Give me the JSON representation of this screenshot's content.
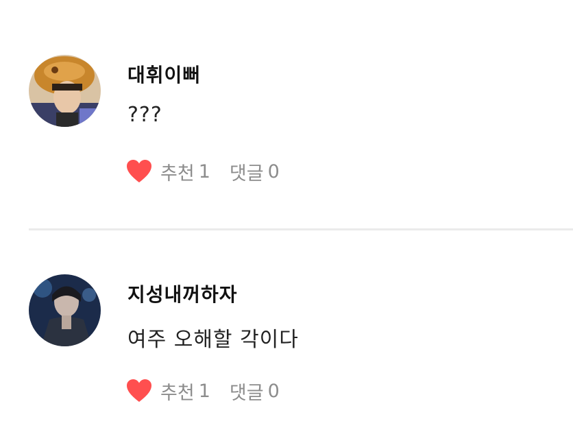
{
  "comments": [
    {
      "author": "대휘이뻐",
      "text": "???",
      "like_label": "추천",
      "like_count": "1",
      "reply_label": "댓글",
      "reply_count": "0",
      "heart_color": "#ff4f4f"
    },
    {
      "author": "지성내꺼하자",
      "text": "여주 오해할 각이다",
      "like_label": "추천",
      "like_count": "1",
      "reply_label": "댓글",
      "reply_count": "0",
      "heart_color": "#ff4f4f"
    }
  ]
}
